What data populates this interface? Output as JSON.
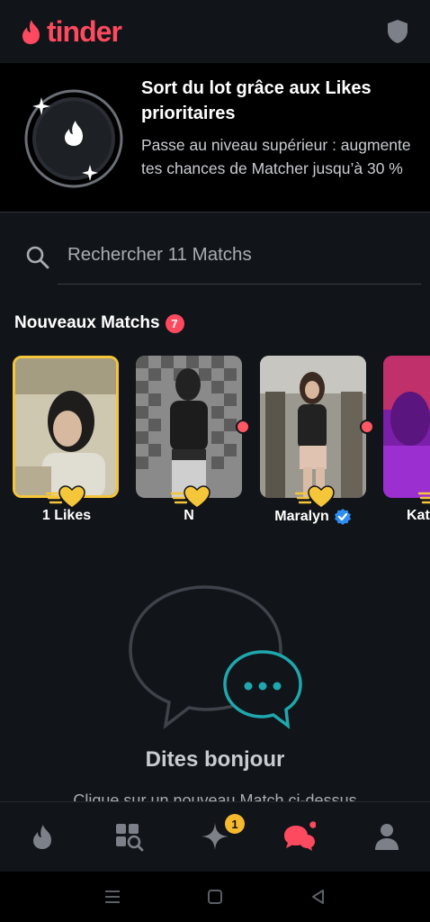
{
  "header": {
    "brand": "tinder"
  },
  "promo": {
    "title": "Sort du lot grâce aux Likes prioritaires",
    "description": "Passe au niveau supérieur : augmente tes chances de Matcher jusqu’à 30 %"
  },
  "search": {
    "placeholder": "Rechercher 11 Matchs"
  },
  "new_matches": {
    "title": "Nouveaux Matchs",
    "count": "7",
    "items": [
      {
        "name": "1 Likes",
        "verified": false,
        "online": false
      },
      {
        "name": "N",
        "verified": false,
        "online": true
      },
      {
        "name": "Maralyn",
        "verified": true,
        "online": true
      },
      {
        "name": "Kat",
        "verified": false,
        "online": false
      }
    ]
  },
  "empty_state": {
    "title": "Dites bonjour",
    "subtitle": "Clique sur un nouveau Match ci-dessus"
  },
  "bottom_nav": {
    "items": [
      "home-icon",
      "explore-icon",
      "sparkle-icon",
      "chat-icon",
      "profile-icon"
    ],
    "sparkle_badge": "1"
  },
  "colors": {
    "accent": "#fd4a5f",
    "gold": "#f5c53a",
    "background": "#111418"
  }
}
